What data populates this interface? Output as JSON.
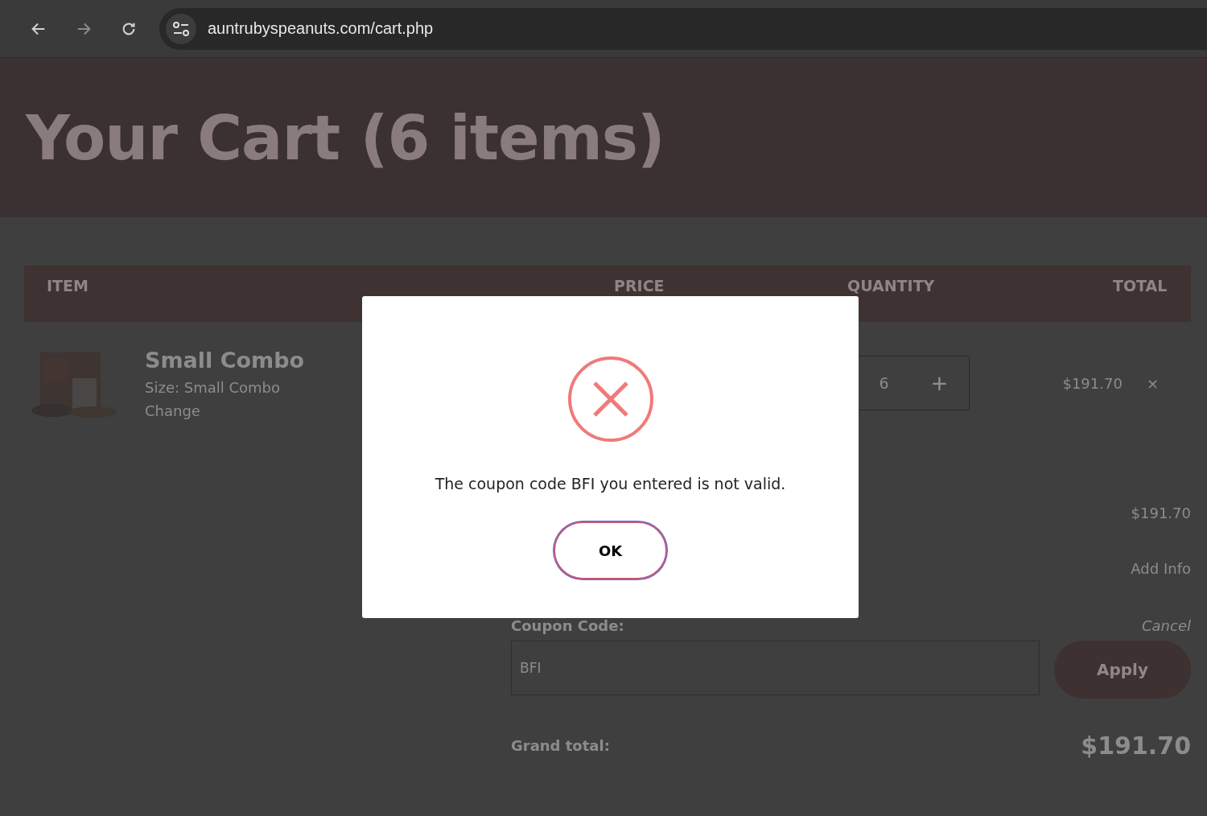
{
  "browser": {
    "url": "auntrubyspeanuts.com/cart.php"
  },
  "hero": {
    "title": "Your Cart (6 items)"
  },
  "table": {
    "columns": [
      "ITEM",
      "PRICE",
      "QUANTITY",
      "TOTAL"
    ],
    "rows": [
      {
        "name": "Small Combo",
        "size": "Size: Small Combo",
        "change": "Change",
        "quantity": "6",
        "plus": "+",
        "total": "$191.70",
        "remove": "×"
      }
    ]
  },
  "summary": {
    "subtotal": "$191.70",
    "add_info": "Add Info",
    "coupon_label": "Coupon Code:",
    "cancel": "Cancel",
    "coupon_value": "BFI",
    "apply": "Apply",
    "grand_label": "Grand total:",
    "grand_value": "$191.70"
  },
  "dialog": {
    "message": "The coupon code BFI you entered is not valid.",
    "ok": "OK"
  }
}
